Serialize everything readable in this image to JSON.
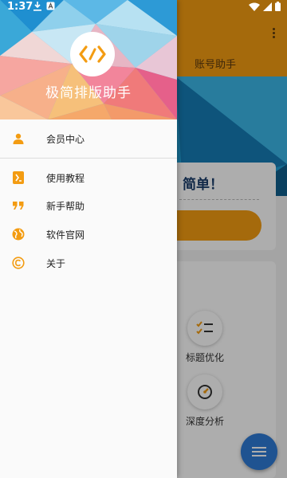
{
  "status_bar": {
    "time": "1:37"
  },
  "background": {
    "tab_label": "账号助手",
    "slogan": "简单！",
    "tools": [
      {
        "label": "标题优化",
        "icon": "checklist-icon"
      },
      {
        "label": "深度分析",
        "icon": "gauge-icon"
      }
    ],
    "fab_icon": "menu-icon"
  },
  "drawer": {
    "app_name": "极简排版助手",
    "logo_icon": "code-brackets-icon",
    "menu": [
      {
        "label": "会员中心",
        "icon": "person-icon"
      },
      {
        "label": "使用教程",
        "icon": "book-icon"
      },
      {
        "label": "新手帮助",
        "icon": "quote-icon"
      },
      {
        "label": "软件官网",
        "icon": "globe-icon"
      },
      {
        "label": "关于",
        "icon": "copyright-icon"
      }
    ]
  },
  "colors": {
    "accent": "#f39c12",
    "fab": "#2e7bd6",
    "title_blue": "#1a3d6b"
  }
}
